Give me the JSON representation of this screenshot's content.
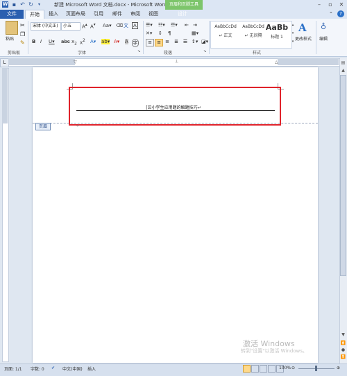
{
  "window": {
    "title": "新建 Microsoft Word 文档.docx - Microsoft Word",
    "context_tab_group": "页眉和页脚工具"
  },
  "tabs": {
    "file": "文件",
    "home": "开始",
    "insert": "插入",
    "page_layout": "页面布局",
    "references": "引用",
    "mailings": "邮件",
    "review": "审阅",
    "view": "视图",
    "design": "设计"
  },
  "ribbon": {
    "clipboard": {
      "paste": "粘贴",
      "group_label": "剪贴板"
    },
    "font": {
      "font_name": "宋体 (中文正)",
      "font_size": "小五",
      "group_label": "字体"
    },
    "paragraph": {
      "group_label": "段落"
    },
    "styles": {
      "items": [
        {
          "sample": "AaBbCcDd",
          "name": "↵ 正文"
        },
        {
          "sample": "AaBbCcDd",
          "name": "↵ 无间隔"
        },
        {
          "sample": "AaBb",
          "name": "标题 1"
        }
      ],
      "change_styles": "更改样式",
      "group_label": "样式"
    },
    "editing": {
      "label": "编辑"
    }
  },
  "document": {
    "header_text": "[ㄖ小学生应用题的解题技巧↵",
    "header_tag": "页眉",
    "para_mark": "↵"
  },
  "watermark": {
    "line1": "激活 Windows",
    "line2": "转到\"设置\"以激活 Windows。"
  },
  "status": {
    "page": "页面: 1/1",
    "words": "字数: 0",
    "language": "中文(中国)",
    "mode": "插入",
    "zoom": "100%"
  }
}
